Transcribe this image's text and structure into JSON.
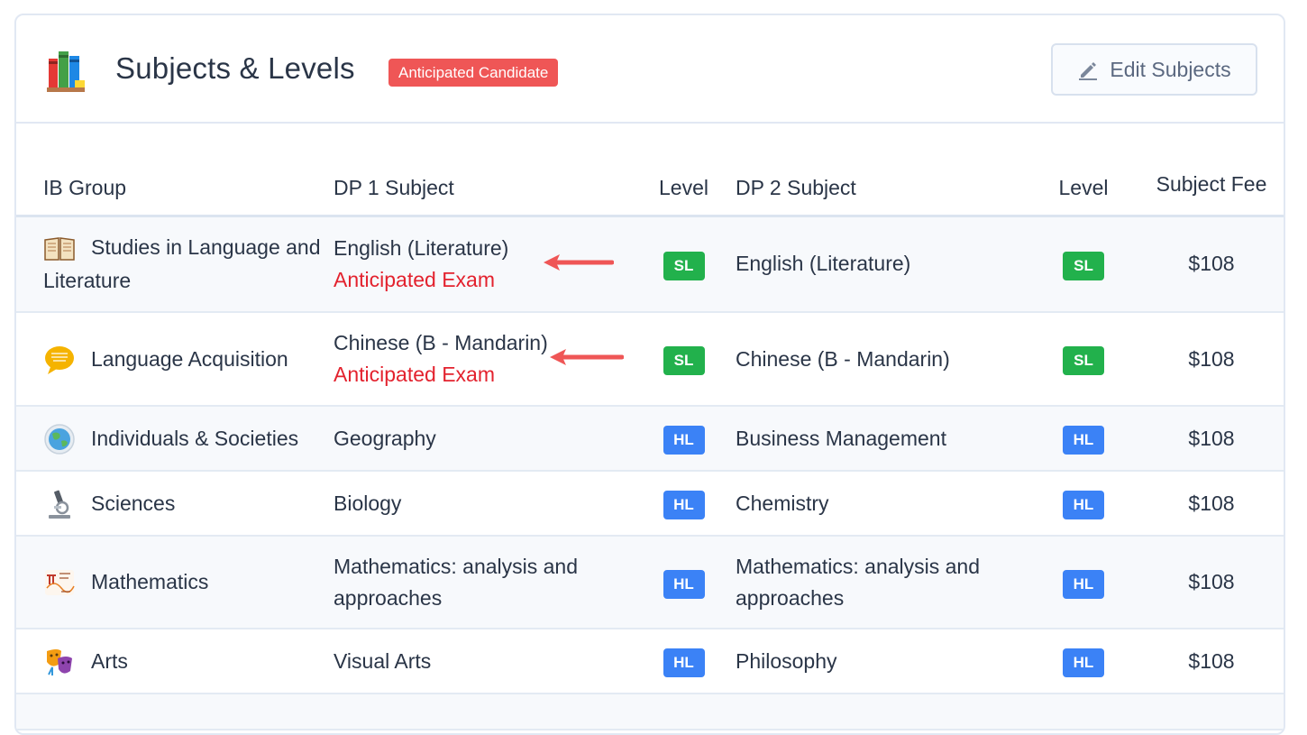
{
  "header": {
    "title": "Subjects & Levels",
    "badge": "Anticipated Candidate",
    "edit_button": "Edit Subjects",
    "icon": "books-icon"
  },
  "table": {
    "headers": {
      "group": "IB Group",
      "dp1": "DP 1 Subject",
      "level1": "Level",
      "dp2": "DP 2 Subject",
      "level2": "Level",
      "fee": "Subject Fee"
    },
    "rows": [
      {
        "icon": "open-book-icon",
        "group": "Studies in Language and Literature",
        "dp1": "English (Literature)",
        "dp1_note": "Anticipated Exam",
        "level1": "SL",
        "dp2": "English (Literature)",
        "level2": "SL",
        "fee": "$108"
      },
      {
        "icon": "speech-bubble-icon",
        "group": "Language Acquisition",
        "dp1": "Chinese (B - Mandarin)",
        "dp1_note": "Anticipated Exam",
        "level1": "SL",
        "dp2": "Chinese (B - Mandarin)",
        "level2": "SL",
        "fee": "$108"
      },
      {
        "icon": "globe-icon",
        "group": "Individuals & Societies",
        "dp1": "Geography",
        "level1": "HL",
        "dp2": "Business Management",
        "level2": "HL",
        "fee": "$108"
      },
      {
        "icon": "microscope-icon",
        "group": "Sciences",
        "dp1": "Biology",
        "level1": "HL",
        "dp2": "Chemistry",
        "level2": "HL",
        "fee": "$108"
      },
      {
        "icon": "math-symbols-icon",
        "group": "Mathematics",
        "dp1": "Mathematics: analysis and approaches",
        "level1": "HL",
        "dp2": "Mathematics: analysis and approaches",
        "level2": "HL",
        "fee": "$108"
      },
      {
        "icon": "theater-masks-icon",
        "group": "Arts",
        "dp1": "Visual Arts",
        "level1": "HL",
        "dp2": "Philosophy",
        "level2": "HL",
        "fee": "$108"
      }
    ]
  },
  "colors": {
    "badge": "#ef5656",
    "sl": "#22b14c",
    "hl": "#3b82f6",
    "anticipated": "#e3222e",
    "arrow": "#ef5656"
  }
}
